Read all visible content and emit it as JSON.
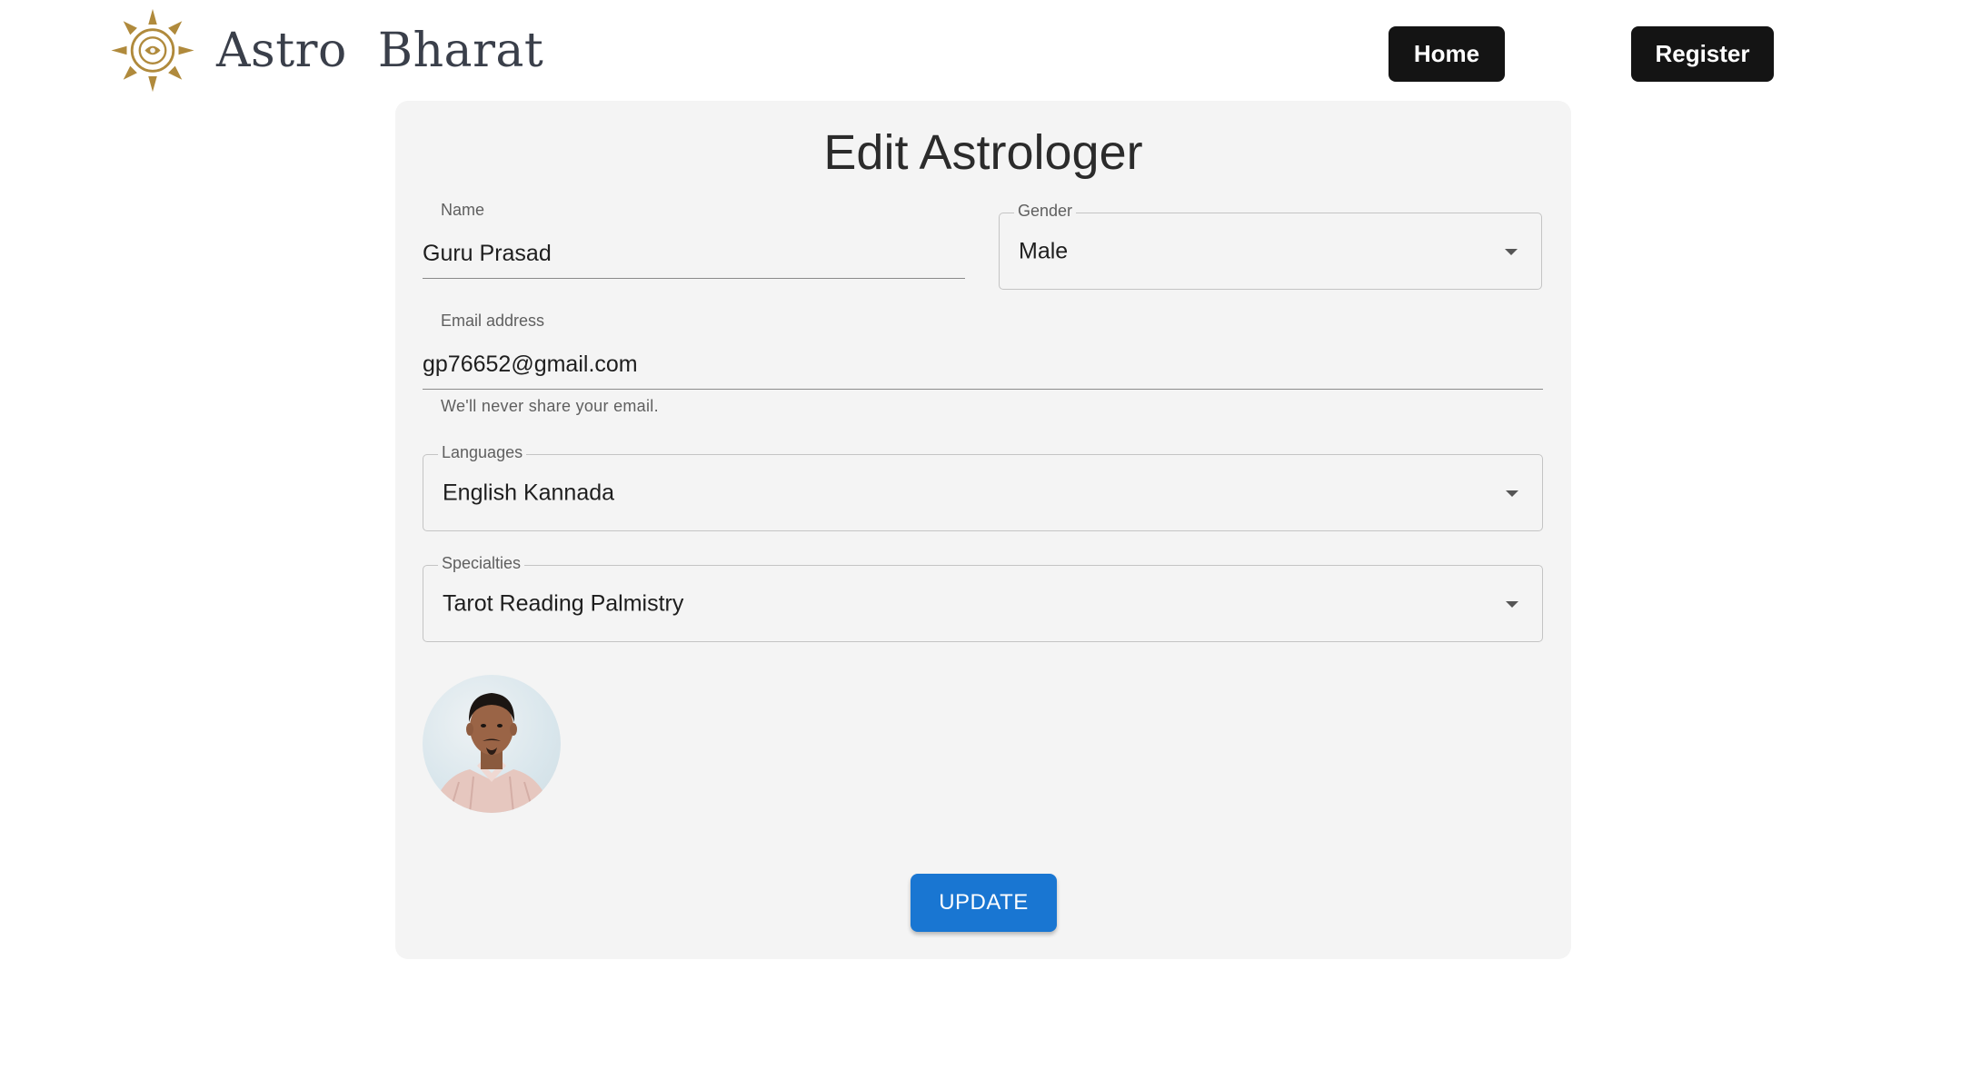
{
  "header": {
    "brand_name": "Astro  Bharat",
    "logo_icon": "sun-eye-logo-icon",
    "nav": {
      "home_label": "Home",
      "register_label": "Register"
    },
    "colors": {
      "nav_bg": "#141414",
      "logo_gold": "#b08a3c"
    }
  },
  "form": {
    "title": "Edit Astrologer",
    "name": {
      "label": "Name",
      "value": "Guru Prasad"
    },
    "gender": {
      "label": "Gender",
      "value": "Male"
    },
    "email": {
      "label": "Email address",
      "value": "gp76652@gmail.com",
      "helper": "We'll never share your email."
    },
    "languages": {
      "label": "Languages",
      "value": "English Kannada"
    },
    "specialties": {
      "label": "Specialties",
      "value": "Tarot Reading Palmistry"
    },
    "avatar": "profile-photo",
    "submit_label": "UPDATE",
    "colors": {
      "primary": "#1976d2",
      "card_bg": "#f4f4f4"
    }
  }
}
